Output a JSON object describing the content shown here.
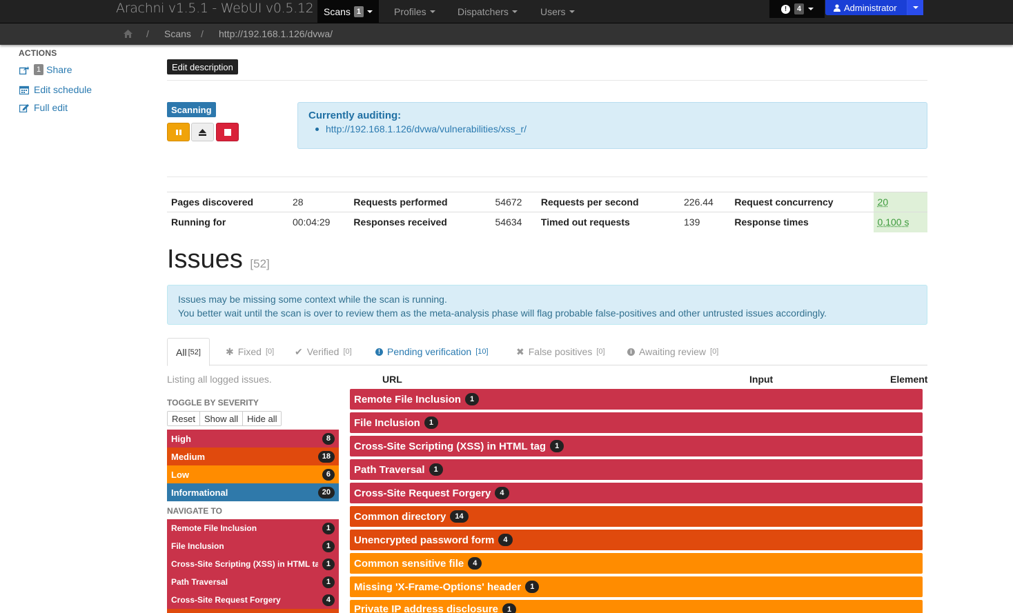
{
  "navbar": {
    "brand": "Arachni v1.5.1 - WebUI v0.5.12",
    "scans_label": "Scans",
    "scans_badge": "1",
    "profiles_label": "Profiles",
    "dispatchers_label": "Dispatchers",
    "users_label": "Users",
    "notifications_count": "4",
    "user_label": "Administrator"
  },
  "breadcrumb": {
    "items": [
      "Scans",
      "http://192.168.1.126/dvwa/"
    ]
  },
  "sidebar": {
    "heading": "ACTIONS",
    "share_badge": "1",
    "share_label": "Share",
    "edit_schedule_label": "Edit schedule",
    "full_edit_label": "Full edit"
  },
  "main": {
    "edit_description_label": "Edit description",
    "status_label": "Scanning",
    "auditing": {
      "heading": "Currently auditing:",
      "url": "http://192.168.1.126/dvwa/vulnerabilities/xss_r/"
    },
    "stats": {
      "pages_discovered_label": "Pages discovered",
      "pages_discovered": "28",
      "running_for_label": "Running for",
      "running_for": "00:04:29",
      "requests_performed_label": "Requests performed",
      "requests_performed": "54672",
      "responses_received_label": "Responses received",
      "responses_received": "54634",
      "requests_per_second_label": "Requests per second",
      "requests_per_second": "226.44",
      "timed_out_label": "Timed out requests",
      "timed_out": "139",
      "concurrency_label": "Request concurrency",
      "concurrency": "20",
      "response_times_label": "Response times",
      "response_times": "0.100 s"
    },
    "issues_title": "Issues",
    "issues_count": "[52]",
    "info_line1": "Issues may be missing some context while the scan is running.",
    "info_line2": "You better wait until the scan is over to review them as the meta-analysis phase will flag probable false-positives and other untrusted issues accordingly.",
    "tabs": [
      {
        "label": "All",
        "count": "[52]"
      },
      {
        "label": "Fixed",
        "count": "[0]"
      },
      {
        "label": "Verified",
        "count": "[0]"
      },
      {
        "label": "Pending verification",
        "count": "[10]"
      },
      {
        "label": "False positives",
        "count": "[0]"
      },
      {
        "label": "Awaiting review",
        "count": "[0]"
      }
    ],
    "listing_text": "Listing all logged issues.",
    "toggle_heading": "TOGGLE BY SEVERITY",
    "toggle_buttons": [
      "Reset",
      "Show all",
      "Hide all"
    ],
    "severities": [
      {
        "label": "High",
        "count": "8",
        "color": "#c9334a"
      },
      {
        "label": "Medium",
        "count": "18",
        "color": "#e04a0d"
      },
      {
        "label": "Low",
        "count": "6",
        "color": "#ff8c00"
      },
      {
        "label": "Informational",
        "count": "20",
        "color": "#2f79aa"
      }
    ],
    "navigate_heading": "NAVIGATE TO",
    "navigate": [
      {
        "label": "Remote File Inclusion",
        "count": "1"
      },
      {
        "label": "File Inclusion",
        "count": "1"
      },
      {
        "label": "Cross-Site Scripting (XSS) in HTML tag",
        "count": "1"
      },
      {
        "label": "Path Traversal",
        "count": "1"
      },
      {
        "label": "Cross-Site Request Forgery",
        "count": "4"
      }
    ],
    "columns": {
      "url": "URL",
      "input": "Input",
      "element": "Element"
    },
    "issue_rows": [
      {
        "label": "Remote File Inclusion",
        "count": "1",
        "severity": "high"
      },
      {
        "label": "File Inclusion",
        "count": "1",
        "severity": "high"
      },
      {
        "label": "Cross-Site Scripting (XSS) in HTML tag",
        "count": "1",
        "severity": "high"
      },
      {
        "label": "Path Traversal",
        "count": "1",
        "severity": "high"
      },
      {
        "label": "Cross-Site Request Forgery",
        "count": "4",
        "severity": "high"
      },
      {
        "label": "Common directory",
        "count": "14",
        "severity": "medium"
      },
      {
        "label": "Unencrypted password form",
        "count": "4",
        "severity": "medium"
      },
      {
        "label": "Common sensitive file",
        "count": "4",
        "severity": "low"
      },
      {
        "label": "Missing 'X-Frame-Options' header",
        "count": "1",
        "severity": "low"
      },
      {
        "label": "Private IP address disclosure",
        "count": "1",
        "severity": "low"
      }
    ]
  }
}
